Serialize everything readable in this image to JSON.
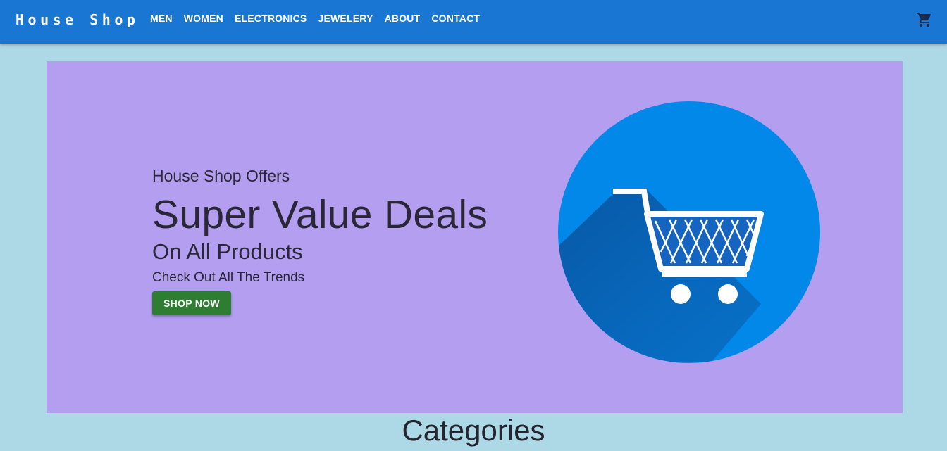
{
  "header": {
    "brand": "House Shop",
    "nav": [
      {
        "label": "MEN"
      },
      {
        "label": "WOMEN"
      },
      {
        "label": "ELECTRONICS"
      },
      {
        "label": "JEWELERY"
      },
      {
        "label": "ABOUT"
      },
      {
        "label": "CONTACT"
      }
    ],
    "cart_icon": "shopping-cart-icon"
  },
  "hero": {
    "eyebrow": "House Shop Offers",
    "headline": "Super Value Deals",
    "subheadline": "On All Products",
    "tagline": "Check Out All The Trends",
    "cta_label": "SHOP NOW",
    "illustration_icon": "shopping-cart-circle-icon"
  },
  "sections": {
    "categories_title": "Categories"
  },
  "colors": {
    "appbar": "#1976d2",
    "page_bg": "#add8e6",
    "hero_bg": "#b39ef0",
    "cta": "#2e7d32",
    "circle": "#0288e8"
  }
}
